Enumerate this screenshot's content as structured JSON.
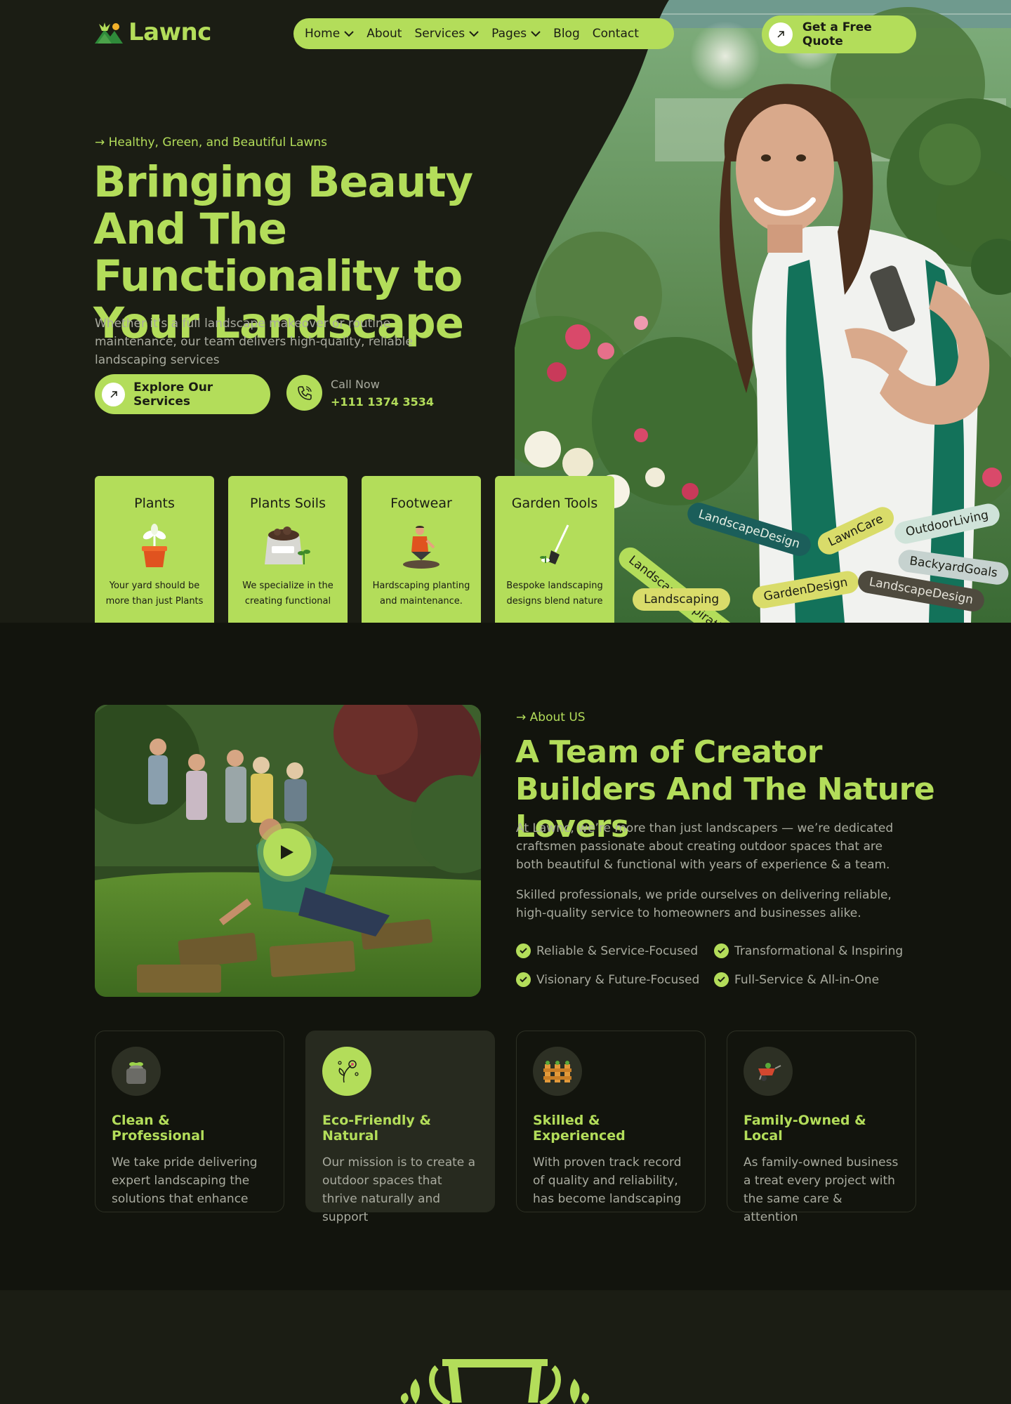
{
  "brand": {
    "name": "Lawnc",
    "accent": "#b3dd5a",
    "bg": "#1b1d14"
  },
  "nav": {
    "items": [
      {
        "label": "Home",
        "dropdown": true
      },
      {
        "label": "About",
        "dropdown": false
      },
      {
        "label": "Services",
        "dropdown": true
      },
      {
        "label": "Pages",
        "dropdown": true
      },
      {
        "label": "Blog",
        "dropdown": false
      },
      {
        "label": "Contact",
        "dropdown": false
      }
    ],
    "cta": "Get a Free Quote"
  },
  "hero": {
    "eyebrow": "→ Healthy, Green, and Beautiful Lawns",
    "title": "Bringing Beauty And The Functionality to Your Landscape",
    "description": "Whether it's a full landscape makeover or routine maintenance, our team delivers high-quality, reliable landscaping services",
    "primary_button": "Explore Our Services",
    "call_label": "Call Now",
    "call_number": "+111 1374 3534"
  },
  "categories": [
    {
      "title": "Plants",
      "icon": "potted-plant-icon",
      "desc": "Your yard should be more than just Plants"
    },
    {
      "title": "Plants Soils",
      "icon": "soil-bag-icon",
      "desc": "We specialize in the creating functional"
    },
    {
      "title": "Footwear",
      "icon": "gardener-icon",
      "desc": "Hardscaping planting and maintenance."
    },
    {
      "title": "Garden Tools",
      "icon": "shovel-icon",
      "desc": "Bespoke landscaping designs blend nature"
    }
  ],
  "tags": [
    "LandscapeDesign",
    "LawnCare",
    "OutdoorLiving",
    "LandscapeInspiration",
    "BackyardGoals",
    "GardenDesign",
    "LandscapeDesign",
    "Landscaping"
  ],
  "about": {
    "eyebrow": "→ About US",
    "title": "A Team of Creator Builders And The Nature Lovers",
    "p1": "At Lawnc, we’re more than just landscapers — we’re dedicated craftsmen passionate about creating outdoor spaces that are both beautiful & functional with years of experience & a team.",
    "p2": "Skilled professionals, we pride ourselves on delivering reliable, high-quality service to homeowners and businesses alike.",
    "checks": [
      "Reliable & Service-Focused",
      "Transformational & Inspiring",
      "Visionary & Future-Focused",
      "Full-Service & All-in-One"
    ]
  },
  "features": [
    {
      "title": "Clean & Professional",
      "icon": "planter-icon",
      "desc": "We take pride delivering expert landscaping the solutions that enhance"
    },
    {
      "title": "Eco-Friendly & Natural",
      "icon": "flower-icon",
      "desc": "Our mission is to create a outdoor spaces that thrive naturally and support"
    },
    {
      "title": "Skilled & Experienced",
      "icon": "fence-icon",
      "desc": "With proven track record of quality and reliability, has become landscaping"
    },
    {
      "title": "Family-Owned & Local",
      "icon": "wheelbarrow-icon",
      "desc": "As family-owned business a treat every project with the same care & attention"
    }
  ]
}
